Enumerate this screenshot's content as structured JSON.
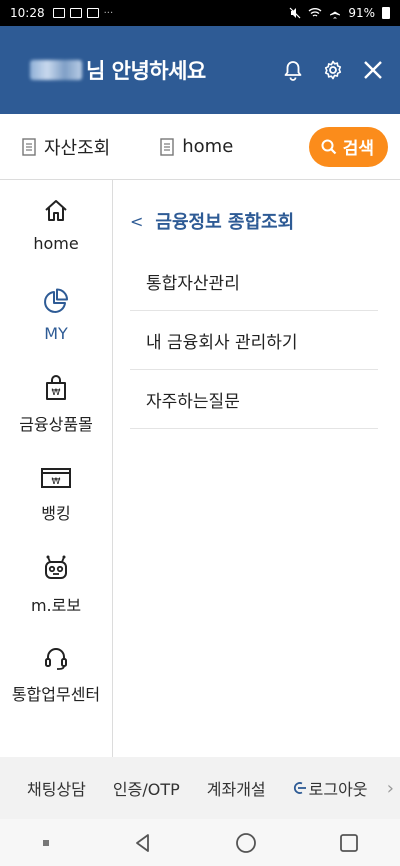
{
  "status_bar": {
    "time": "10:28",
    "battery": "91%"
  },
  "header": {
    "greeting": "님 안녕하세요"
  },
  "quickbar": {
    "items": [
      {
        "label": "자산조회"
      },
      {
        "label": "home"
      }
    ],
    "search_label": "검색"
  },
  "sidebar": {
    "items": [
      {
        "label": "home"
      },
      {
        "label": "MY"
      },
      {
        "label": "금융상품몰"
      },
      {
        "label": "뱅킹"
      },
      {
        "label": "m.로보"
      },
      {
        "label": "통합업무센터"
      }
    ],
    "won_symbol": "₩"
  },
  "content": {
    "breadcrumb": "금융정보 종합조회",
    "menu": [
      {
        "label": "통합자산관리"
      },
      {
        "label": "내 금융회사 관리하기"
      },
      {
        "label": "자주하는질문"
      }
    ]
  },
  "bottom_bar": {
    "items": [
      {
        "label": "채팅상담"
      },
      {
        "label": "인증/OTP"
      },
      {
        "label": "계좌개설"
      },
      {
        "label": "로그아웃"
      }
    ]
  },
  "colors": {
    "header_bg": "#2e5b95",
    "accent": "#fb8c1b",
    "active": "#2e5b95"
  }
}
